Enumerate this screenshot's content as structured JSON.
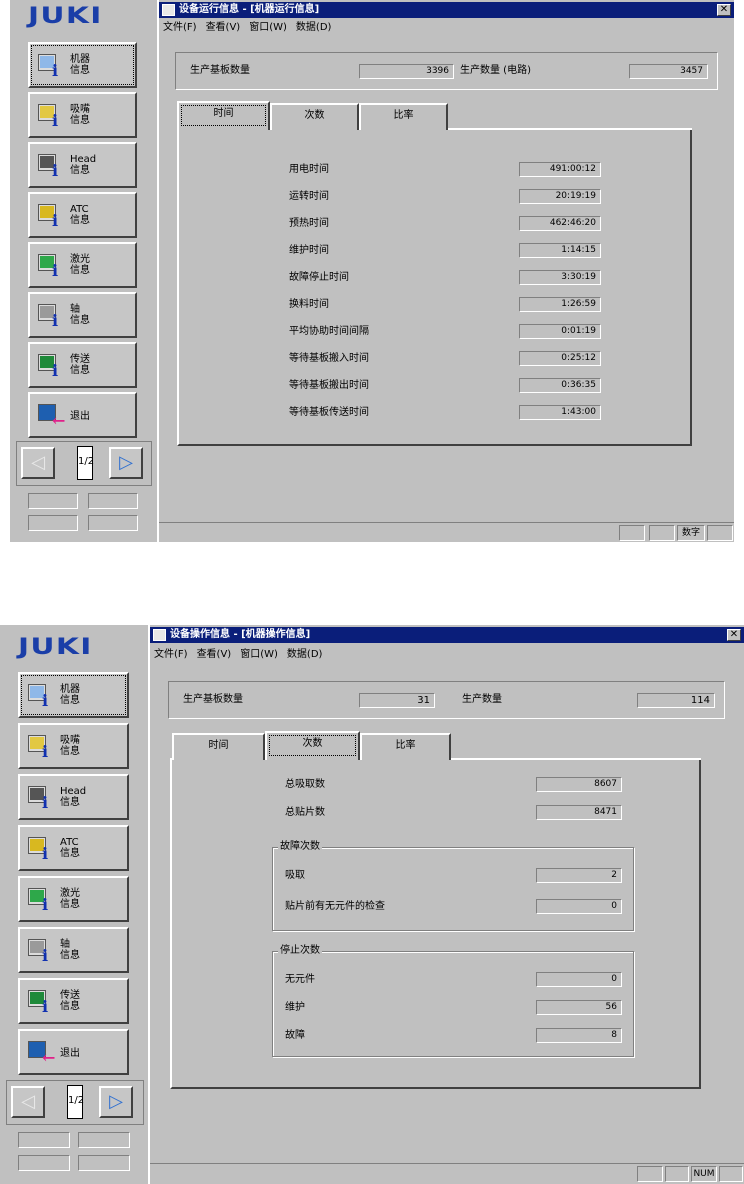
{
  "sidebar": {
    "logo": "JUKI",
    "buttons": [
      {
        "label": "机器\n信息",
        "icon": "machine-info-icon"
      },
      {
        "label": "吸嘴\n信息",
        "icon": "nozzle-info-icon"
      },
      {
        "label": "Head\n信息",
        "icon": "head-info-icon"
      },
      {
        "label": "ATC\n信息",
        "icon": "atc-info-icon"
      },
      {
        "label": "激光\n信息",
        "icon": "laser-info-icon"
      },
      {
        "label": "轴\n信息",
        "icon": "axis-info-icon"
      },
      {
        "label": "传送\n信息",
        "icon": "conveyor-info-icon"
      },
      {
        "label": "退出",
        "icon": "exit-door-icon"
      }
    ],
    "pager": {
      "prev": "◁",
      "page": "1/2",
      "next": "▷"
    }
  },
  "menu": [
    "文件(F)",
    "查看(V)",
    "窗口(W)",
    "数据(D)"
  ],
  "menu2": [
    "文件(F)",
    "查看(V)",
    "窗口(W)",
    "数据(D)"
  ],
  "tabs": [
    "时间",
    "次数",
    "比率"
  ],
  "window1": {
    "title": "设备运行信息 - [机器运行信息]",
    "board_label": "生产基板数量",
    "board_value": "3396",
    "prod_label": "生产数量 (电路)",
    "prod_value": "3457",
    "active_tab": "时间",
    "rows": [
      {
        "label": "用电时间",
        "value": "491:00:12"
      },
      {
        "label": "运转时间",
        "value": "20:19:19"
      },
      {
        "label": "预热时间",
        "value": "462:46:20"
      },
      {
        "label": "维护时间",
        "value": "1:14:15"
      },
      {
        "label": "故障停止时间",
        "value": "3:30:19"
      },
      {
        "label": "换料时间",
        "value": "1:26:59"
      },
      {
        "label": "平均协助时间间隔",
        "value": "0:01:19"
      },
      {
        "label": "等待基板搬入时间",
        "value": "0:25:12"
      },
      {
        "label": "等待基板搬出时间",
        "value": "0:36:35"
      },
      {
        "label": "等待基板传送时间",
        "value": "1:43:00"
      }
    ],
    "status": [
      "",
      "",
      "数字",
      ""
    ]
  },
  "window2": {
    "title": "设备操作信息 - [机器操作信息]",
    "board_label": "生产基板数量",
    "board_value": "31",
    "prod_label": "生产数量",
    "prod_value": "114",
    "active_tab": "次数",
    "top_rows": [
      {
        "label": "总吸取数",
        "value": "8607"
      },
      {
        "label": "总贴片数",
        "value": "8471"
      }
    ],
    "fault_group": {
      "title": "故障次数",
      "rows": [
        {
          "label": "吸取",
          "value": "2"
        },
        {
          "label": "贴片前有无元件的检查",
          "value": "0"
        }
      ]
    },
    "stop_group": {
      "title": "停止次数",
      "rows": [
        {
          "label": "无元件",
          "value": "0"
        },
        {
          "label": "维护",
          "value": "56"
        },
        {
          "label": "故障",
          "value": "8"
        }
      ]
    },
    "status": [
      "",
      "",
      "NUM",
      ""
    ]
  }
}
